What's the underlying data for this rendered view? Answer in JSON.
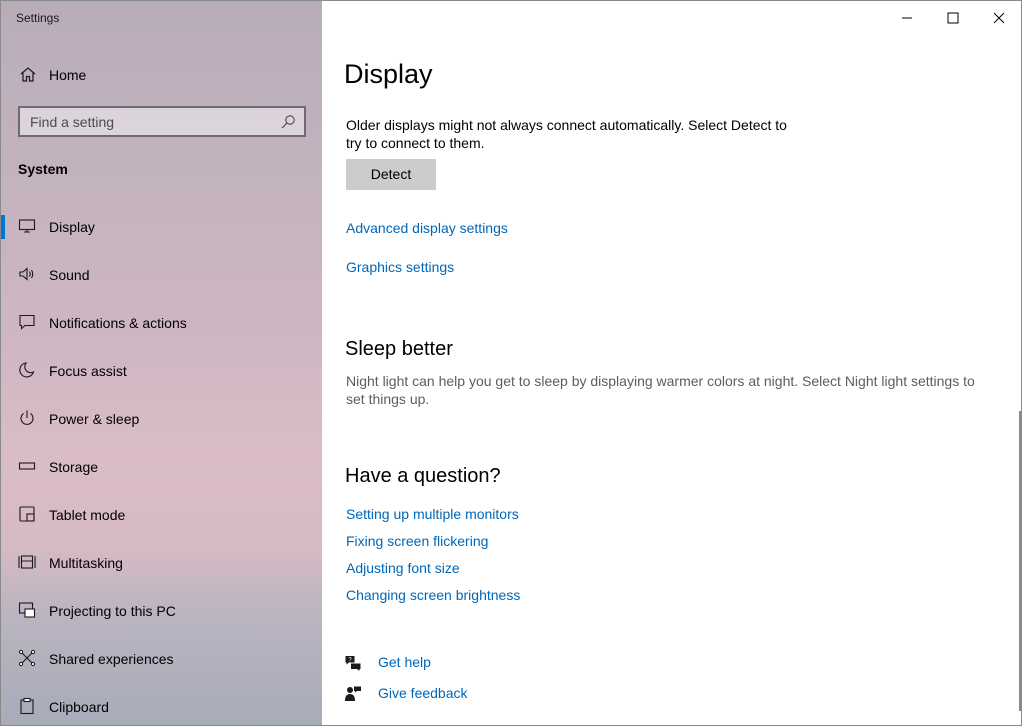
{
  "window": {
    "title": "Settings"
  },
  "sidebar": {
    "home_label": "Home",
    "search_placeholder": "Find a setting",
    "section_title": "System",
    "items": [
      {
        "label": "Display",
        "icon": "monitor-icon",
        "selected": true
      },
      {
        "label": "Sound",
        "icon": "speaker-icon"
      },
      {
        "label": "Notifications & actions",
        "icon": "message-icon"
      },
      {
        "label": "Focus assist",
        "icon": "moon-icon"
      },
      {
        "label": "Power & sleep",
        "icon": "power-icon"
      },
      {
        "label": "Storage",
        "icon": "storage-icon"
      },
      {
        "label": "Tablet mode",
        "icon": "tablet-icon"
      },
      {
        "label": "Multitasking",
        "icon": "multitasking-icon"
      },
      {
        "label": "Projecting to this PC",
        "icon": "projecting-icon"
      },
      {
        "label": "Shared experiences",
        "icon": "shared-icon"
      },
      {
        "label": "Clipboard",
        "icon": "clipboard-icon"
      }
    ]
  },
  "main": {
    "title": "Display",
    "detect_text": "Older displays might not always connect automatically. Select Detect to try to connect to them.",
    "detect_button": "Detect",
    "links": {
      "advanced": "Advanced display settings",
      "graphics": "Graphics settings"
    },
    "sleep": {
      "title": "Sleep better",
      "text": "Night light can help you get to sleep by displaying warmer colors at night. Select Night light settings to set things up."
    },
    "question": {
      "title": "Have a question?",
      "links": [
        "Setting up multiple monitors",
        "Fixing screen flickering",
        "Adjusting font size",
        "Changing screen brightness"
      ]
    },
    "help": {
      "get_help": "Get help",
      "give_feedback": "Give feedback"
    }
  },
  "colors": {
    "accent": "#0078d4",
    "link": "#0067b8"
  }
}
